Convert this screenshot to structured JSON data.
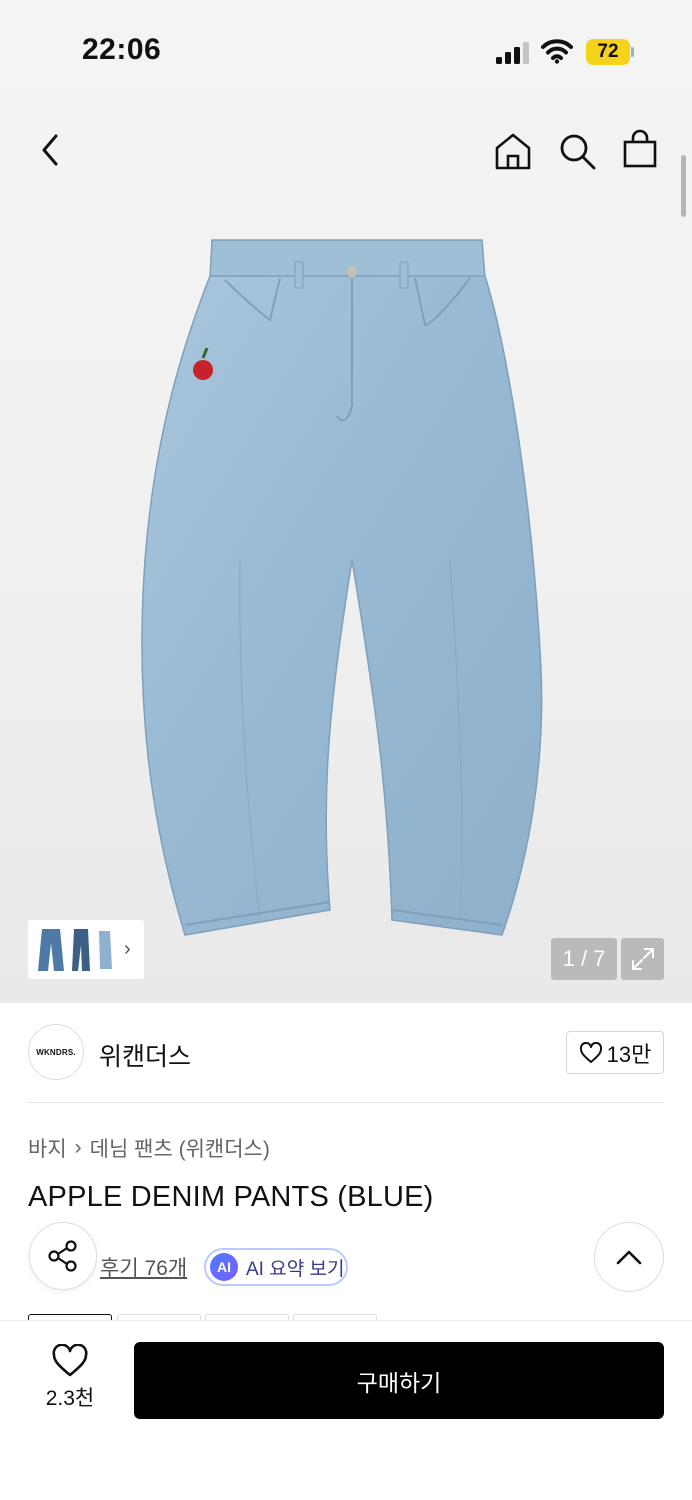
{
  "status_bar": {
    "time": "22:06",
    "battery": "72"
  },
  "header": {
    "back_icon": "chevron-left-icon",
    "icons": [
      "home-icon",
      "search-icon",
      "shopping-bag-icon"
    ]
  },
  "gallery": {
    "counter": "1 / 7",
    "expand_icon": "expand-icon"
  },
  "brand": {
    "logo_text": "WKNDRS.",
    "name": "위캔더스",
    "likes": "13만"
  },
  "breadcrumb": {
    "level1": "바지",
    "level2": "데님 팬츠 (위캔더스)"
  },
  "product": {
    "title": "APPLE DENIM PANTS (BLUE)",
    "reviews": "후기 76개",
    "ai_badge": "AI",
    "ai_summary": "AI 요약 보기"
  },
  "bottom_bar": {
    "wish_count": "2.3천",
    "buy_label": "구매하기"
  },
  "colors": {
    "accent": "#000000",
    "battery": "#f5d31a",
    "denim": "#9bbcd6"
  }
}
